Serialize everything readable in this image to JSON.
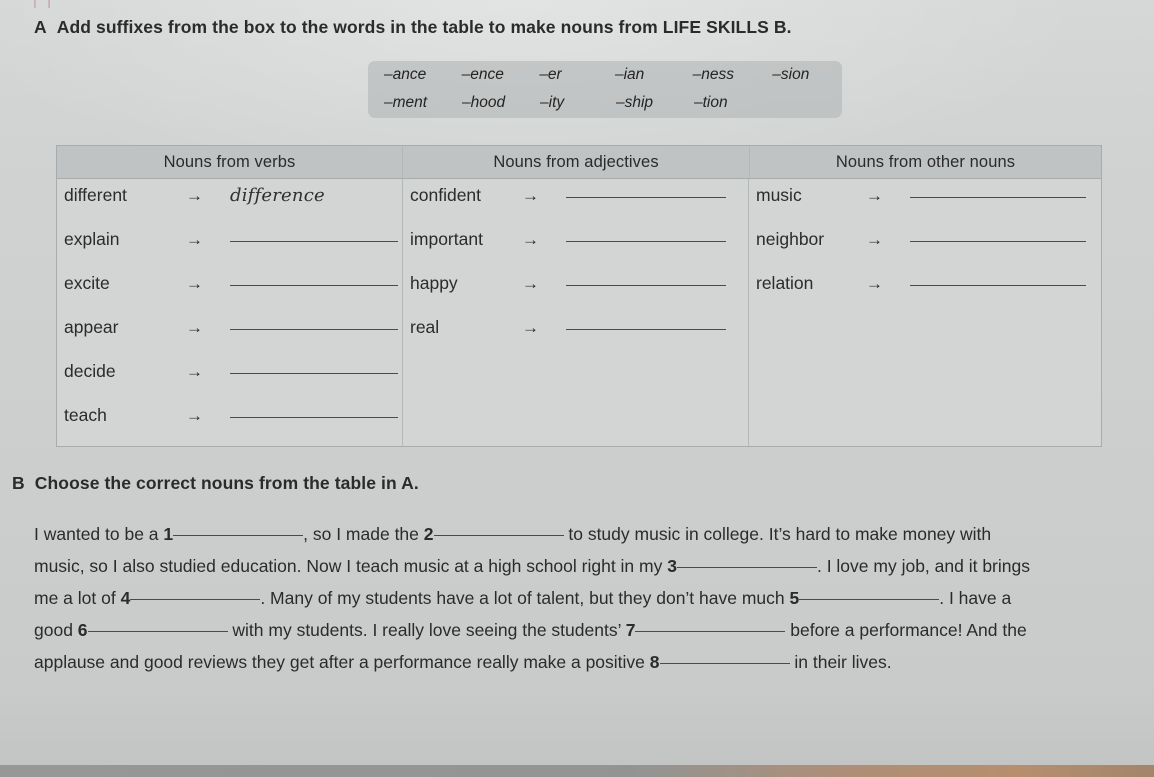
{
  "page": {
    "top_bleed_mark": "|  |"
  },
  "section_a": {
    "letter": "A",
    "title": "Add suffixes from the box to the words in the table to make nouns from LIFE SKILLS B.",
    "suffix_box": {
      "row1": [
        "–ance",
        "–ence",
        "–er",
        "–ian",
        "–ness",
        "–sion"
      ],
      "row2": [
        "–ment",
        "–hood",
        "–ity",
        "–ship",
        "–tion"
      ]
    },
    "table": {
      "headers": [
        "Nouns from verbs",
        "Nouns from adjectives",
        "Nouns from other nouns"
      ],
      "arrow": "→",
      "columns": [
        {
          "header": "Nouns from verbs",
          "rows": [
            {
              "word": "different",
              "answer": "difference"
            },
            {
              "word": "explain",
              "answer": ""
            },
            {
              "word": "excite",
              "answer": ""
            },
            {
              "word": "appear",
              "answer": ""
            },
            {
              "word": "decide",
              "answer": ""
            },
            {
              "word": "teach",
              "answer": ""
            }
          ]
        },
        {
          "header": "Nouns from adjectives",
          "rows": [
            {
              "word": "confident",
              "answer": ""
            },
            {
              "word": "important",
              "answer": ""
            },
            {
              "word": "happy",
              "answer": ""
            },
            {
              "word": "real",
              "answer": ""
            }
          ]
        },
        {
          "header": "Nouns from other nouns",
          "rows": [
            {
              "word": "music",
              "answer": ""
            },
            {
              "word": "neighbor",
              "answer": ""
            },
            {
              "word": "relation",
              "answer": ""
            }
          ]
        }
      ]
    }
  },
  "section_b": {
    "letter": "B",
    "title": "Choose the correct nouns from the table in A.",
    "paragraph": {
      "t1": "I wanted to be a ",
      "n1": "1",
      "t2": ", so I made the ",
      "n2": "2",
      "t3": " to study music in college. It’s hard to make money with music, so I also studied education. Now I teach music at a high school right in my ",
      "n3": "3",
      "t4": ". I love my job, and it brings me a lot of ",
      "n4": "4",
      "t5": ". Many of my students have a lot of talent, but they don’t have much ",
      "n5": "5",
      "t6": ". I have a good ",
      "n6": "6",
      "t7": " with my students. I really love seeing the students’ ",
      "n7": "7",
      "t8": " before a performance! And the applause and good reviews they get after a performance really make a positive ",
      "n8": "8",
      "t9": " in their lives."
    }
  }
}
